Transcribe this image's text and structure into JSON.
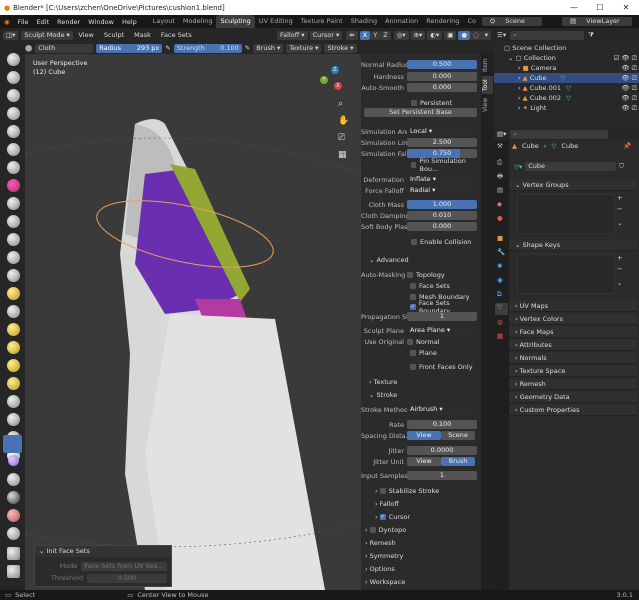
{
  "window": {
    "title": "Blender* [C:\\Users\\zchen\\OneDrive\\Pictures\\cushion1.blend]",
    "minimize": "—",
    "maximize": "☐",
    "close": "✕"
  },
  "menu": {
    "items": [
      "File",
      "Edit",
      "Render",
      "Window",
      "Help"
    ],
    "workspaces": [
      "Layout",
      "Modeling",
      "Sculpting",
      "UV Editing",
      "Texture Paint",
      "Shading",
      "Animation",
      "Rendering",
      "Co"
    ],
    "active_workspace": "Sculpting",
    "scene": "Scene",
    "view_layer": "ViewLayer"
  },
  "header": {
    "mode": "Sculpt Mode",
    "menus": [
      "View",
      "Sculpt",
      "Mask",
      "Face Sets"
    ],
    "xyz": [
      "X",
      "Y",
      "Z"
    ],
    "falloff": "Falloff",
    "cursor": "Cursor"
  },
  "toolsettings": {
    "brush_name": "Cloth",
    "radius_label": "Radius",
    "radius_value": "293 px",
    "strength_label": "Strength",
    "strength_value": "0.100",
    "brush": "Brush",
    "texture": "Texture",
    "stroke": "Stroke"
  },
  "viewport": {
    "perspective": "User Perspective",
    "object": "(12) Cube",
    "gizmo": {
      "x": "X",
      "y": "Y",
      "z": "Z"
    }
  },
  "npanel": {
    "normal_radius": {
      "label": "Normal Radius",
      "value": "0.500"
    },
    "hardness": {
      "label": "Hardness",
      "value": "0.000"
    },
    "auto_smooth": {
      "label": "Auto-Smooth",
      "value": "0.000"
    },
    "persistent": "Persistent",
    "set_persistent_base": "Set Persistent Base",
    "simulation_area": {
      "label": "Simulation Area",
      "value": "Local"
    },
    "simulation_limit": {
      "label": "Simulation Limi",
      "value": "2.500"
    },
    "simulation_falloff": {
      "label": "Simulation Fall...",
      "value": "0.750",
      "fraction": 0.75
    },
    "pin_boundary": "Pin Simulation Bou...",
    "deformation": {
      "label": "Deformation",
      "value": "Inflate"
    },
    "force_falloff": {
      "label": "Force Falloff",
      "value": "Radial"
    },
    "cloth_mass": {
      "label": "Cloth Mass",
      "value": "1.000"
    },
    "cloth_damping": {
      "label": "Cloth Damping",
      "value": "0.010"
    },
    "soft_body": {
      "label": "Soft Body Plas...",
      "value": "0.000"
    },
    "enable_collision": "Enable Collision",
    "advanced": "Advanced",
    "auto_masking": "Auto-Masking",
    "topology": "Topology",
    "face_sets": "Face Sets",
    "mesh_boundary": "Mesh Boundary",
    "face_sets_boundary": "Face Sets Boundary",
    "propagation": {
      "label": "Propagation St...",
      "value": "1"
    },
    "sculpt_plane": {
      "label": "Sculpt Plane",
      "value": "Area Plane"
    },
    "use_original": "Use Original",
    "normal": "Normal",
    "plane": "Plane",
    "front_faces": "Front Faces Only",
    "texture": "Texture",
    "stroke": "Stroke",
    "stroke_method": {
      "label": "Stroke Method",
      "value": "Airbrush"
    },
    "rate": {
      "label": "Rate",
      "value": "0.100"
    },
    "spacing": {
      "label": "Spacing Dista...",
      "view": "View",
      "scene": "Scene"
    },
    "jitter": {
      "label": "Jitter",
      "value": "0.0000"
    },
    "jitter_unit": {
      "label": "Jitter Unit",
      "view": "View",
      "brush": "Brush"
    },
    "input_samples": {
      "label": "Input Samples",
      "value": "1"
    },
    "stabilize": "Stabilize Stroke",
    "falloff": "Falloff",
    "cursor": "Cursor",
    "dyntopo": "Dyntopo",
    "remesh": "Remesh",
    "symmetry": "Symmetry",
    "options": "Options",
    "workspace": "Workspace"
  },
  "ntabs": [
    "Item",
    "Tool",
    "View"
  ],
  "outliner": {
    "collection_root": "Scene Collection",
    "collection": "Collection",
    "objects": [
      "Camera",
      "Cube",
      "Cube.001",
      "Cube.002",
      "Light"
    ]
  },
  "properties": {
    "object": "Cube",
    "data": "Cube",
    "mesh": "Cube",
    "sections": [
      "Vertex Groups",
      "Shape Keys",
      "UV Maps",
      "Vertex Colors",
      "Face Maps",
      "Attributes",
      "Normals",
      "Texture Space",
      "Remesh",
      "Geometry Data",
      "Custom Properties"
    ]
  },
  "last_operator": {
    "title": "Init Face Sets",
    "mode_label": "Mode",
    "mode_value": "Face Sets from UV Sea...",
    "threshold_label": "Threshold",
    "threshold_value": "0.500"
  },
  "status": {
    "select": "Select",
    "center": "Center View to Mouse",
    "version": "3.0.1"
  }
}
